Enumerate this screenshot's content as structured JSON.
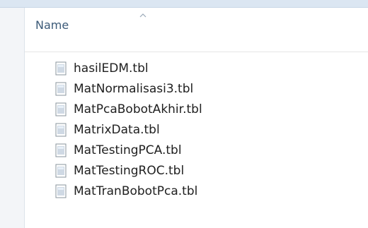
{
  "list_header": {
    "column_label": "Name",
    "sort": "ascending",
    "sort_icon": "sort-up-icon"
  },
  "files": [
    {
      "name": "hasilEDM.tbl",
      "icon": "document-icon"
    },
    {
      "name": "MatNormalisasi3.tbl",
      "icon": "document-icon"
    },
    {
      "name": "MatPcaBobotAkhir.tbl",
      "icon": "document-icon"
    },
    {
      "name": "MatrixData.tbl",
      "icon": "document-icon"
    },
    {
      "name": "MatTestingPCA.tbl",
      "icon": "document-icon"
    },
    {
      "name": "MatTestingROC.tbl",
      "icon": "document-icon"
    },
    {
      "name": "MatTranBobotPca.tbl",
      "icon": "document-icon"
    }
  ],
  "colors": {
    "header_text": "#3c5a78",
    "file_text": "#202020",
    "background": "#ffffff",
    "icon_outline": "#8a949e"
  }
}
